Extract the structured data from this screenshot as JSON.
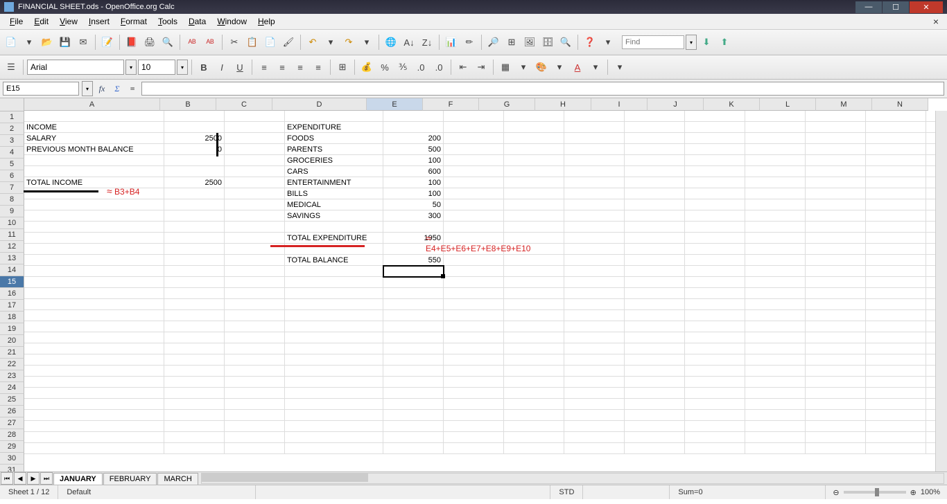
{
  "title": "FINANCIAL SHEET.ods - OpenOffice.org Calc",
  "menus": [
    "File",
    "Edit",
    "View",
    "Insert",
    "Format",
    "Tools",
    "Data",
    "Window",
    "Help"
  ],
  "find_placeholder": "Find",
  "font_name": "Arial",
  "font_size": "10",
  "cell_ref": "E15",
  "formula_input": "",
  "columns": [
    "A",
    "B",
    "C",
    "D",
    "E",
    "F",
    "G",
    "H",
    "I",
    "J",
    "K",
    "L",
    "M",
    "N"
  ],
  "colwidths": [
    "cw-A",
    "cw-B",
    "cw-C",
    "cw-D",
    "cw-E",
    "cw-F",
    "cw-G",
    "cw-H",
    "cw-I",
    "cw-J",
    "cw-K",
    "cw-L",
    "cw-M",
    "cw-N"
  ],
  "selected_col": "E",
  "selected_row": 15,
  "row_count": 31,
  "cells": {
    "2": {
      "A": "INCOME",
      "D": "EXPENDITURE"
    },
    "3": {
      "A": "   SALARY",
      "B": "2500",
      "D": "FOODS",
      "E": "200"
    },
    "4": {
      "A": "   PREVIOUS MONTH BALANCE",
      "B": "0",
      "D": "PARENTS",
      "E": "500"
    },
    "5": {
      "D": "GROCERIES",
      "E": "100"
    },
    "6": {
      "D": "CARS",
      "E": "600"
    },
    "7": {
      "A": "TOTAL INCOME",
      "B": "2500",
      "D": "ENTERTAINMENT",
      "E": "100"
    },
    "8": {
      "D": "BILLS",
      "E": "100"
    },
    "9": {
      "D": "MEDICAL",
      "E": "50"
    },
    "10": {
      "D": "SAVINGS",
      "E": "300"
    },
    "12": {
      "D": "TOTAL EXPENDITURE",
      "E": "1950"
    },
    "14": {
      "D": "TOTAL BALANCE",
      "E": "550"
    }
  },
  "num_cols": [
    "B",
    "E"
  ],
  "annotations": {
    "formula_income": "B3+B4",
    "formula_expend": "E4+E5+E6+E7+E8+E9+E10"
  },
  "sheet_tabs": [
    "JANUARY",
    "FEBRUARY",
    "MARCH"
  ],
  "active_tab": 0,
  "status": {
    "sheet": "Sheet 1 / 12",
    "style": "Default",
    "mode": "STD",
    "sum": "Sum=0",
    "zoom": "100%"
  }
}
